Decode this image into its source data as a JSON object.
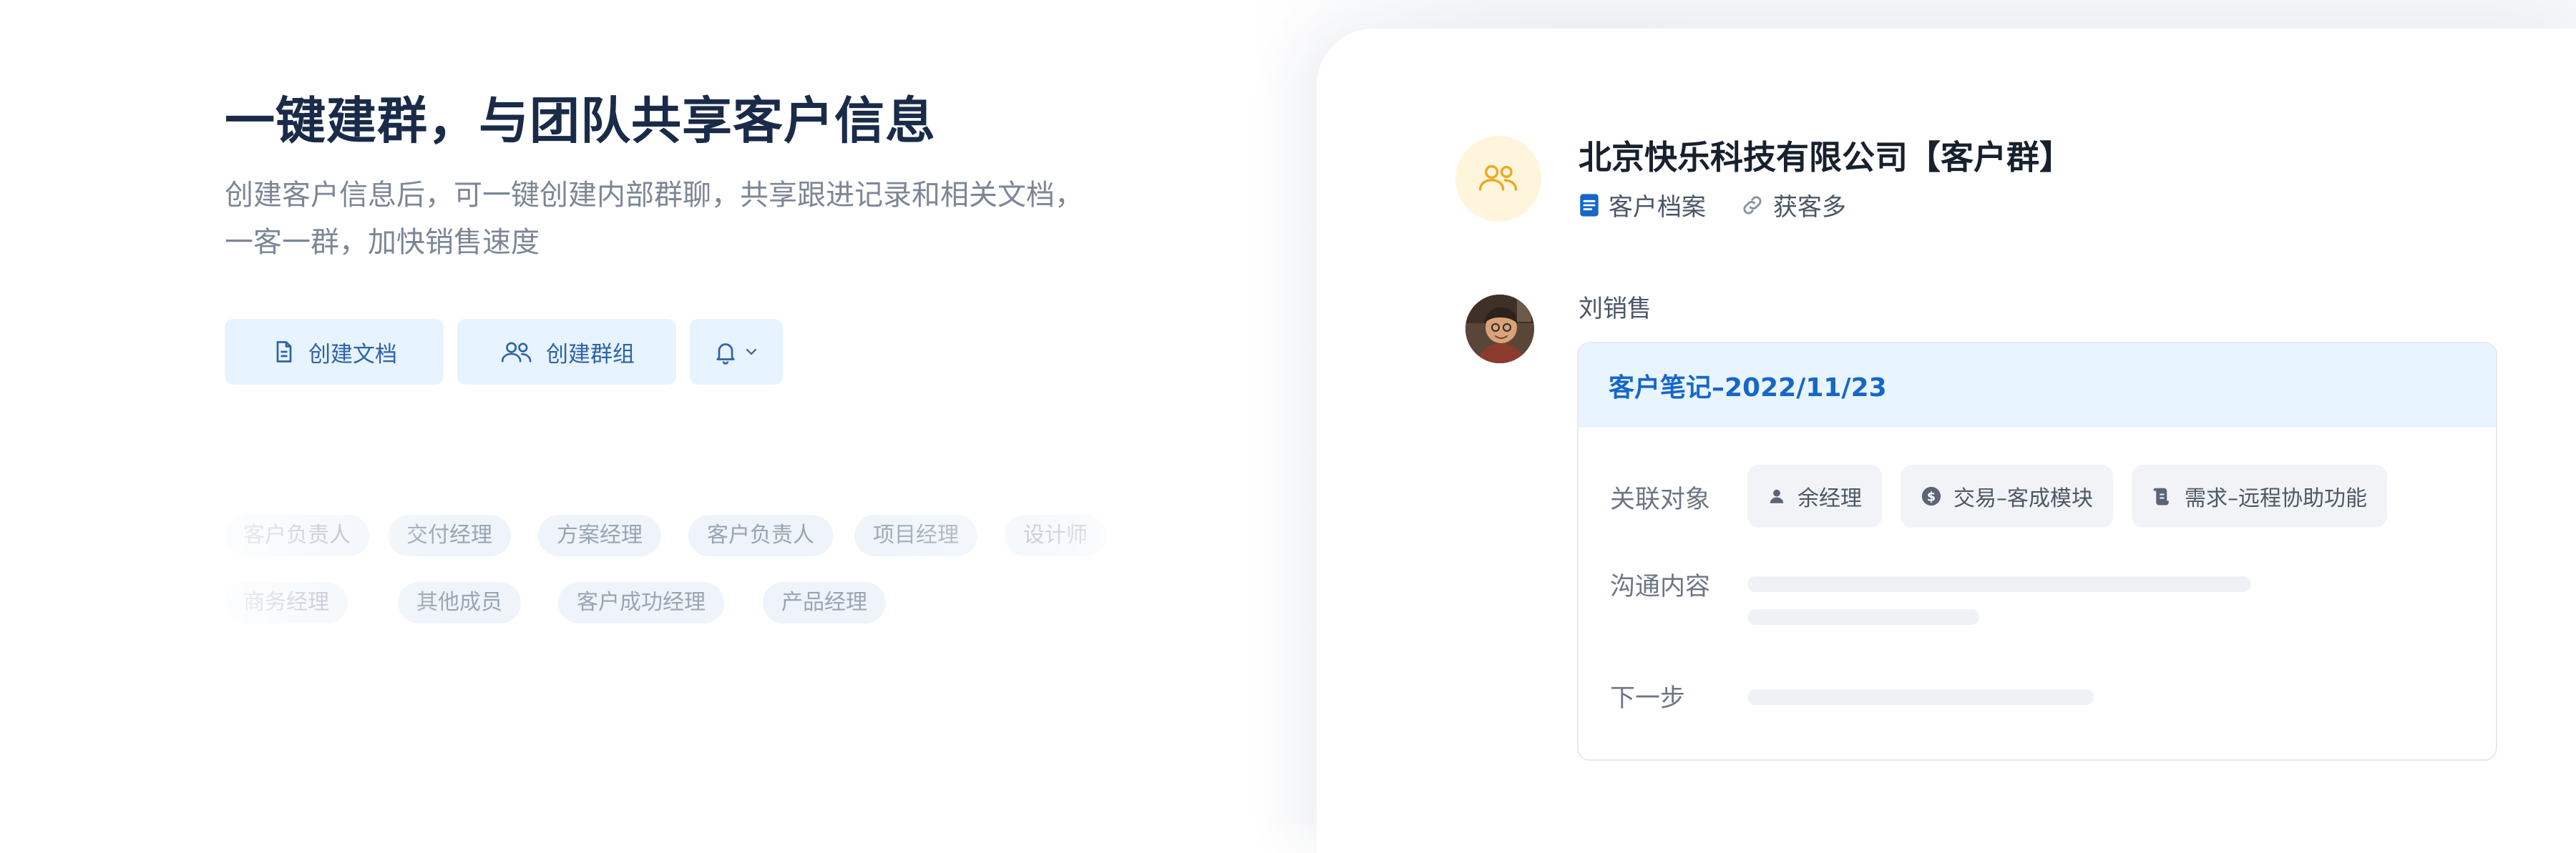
{
  "hero": {
    "title": "一键建群，与团队共享客户信息",
    "subtitle": "创建客户信息后，可一键创建内部群聊，共享跟进记录和相关文档，一客一群，加快销售速度"
  },
  "actions": {
    "create_doc_label": "创建文档",
    "create_group_label": "创建群组"
  },
  "role_tags": {
    "row1": [
      "客户负责人",
      "交付经理",
      "方案经理",
      "客户负责人",
      "项目经理",
      "设计师"
    ],
    "row2": [
      "商务经理",
      "其他成员",
      "客户成功经理",
      "产品经理"
    ]
  },
  "group": {
    "title": "北京快乐科技有限公司【客户群】",
    "links": [
      "客户档案",
      "获客多"
    ]
  },
  "message": {
    "sender": "刘销售",
    "card": {
      "title": "客户笔记–2022/11/23",
      "related_label": "关联对象",
      "related_chips": [
        "余经理",
        "交易–客成模块",
        "需求–远程协助功能"
      ],
      "content_label": "沟通内容",
      "next_label": "下一步"
    }
  },
  "colors": {
    "accent": "#1667c8",
    "button_bg": "#e7f3ff",
    "card_header_bg": "#e8f4ff",
    "group_avatar_bg": "#fff5dc",
    "group_avatar_icon": "#f0a71f",
    "headline": "#1a2b49"
  }
}
